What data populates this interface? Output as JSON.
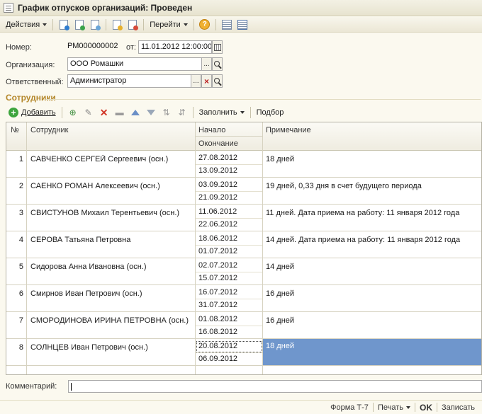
{
  "window": {
    "title": "График отпусков организаций: Проведен"
  },
  "toolbar": {
    "actions_label": "Действия",
    "goto_label": "Перейти"
  },
  "header": {
    "number_label": "Номер:",
    "number_value": "РМ000000002",
    "date_label": "от:",
    "date_value": "11.01.2012 12:00:00",
    "org_label": "Организация:",
    "org_value": "ООО Ромашки",
    "resp_label": "Ответственный:",
    "resp_value": "Администратор"
  },
  "section": {
    "title": "Сотрудники"
  },
  "table_toolbar": {
    "add_label": "Добавить",
    "fill_label": "Заполнить",
    "select_label": "Подбор"
  },
  "table": {
    "columns": {
      "num": "№",
      "employee": "Сотрудник",
      "start": "Начало",
      "end": "Окончание",
      "note": "Примечание"
    },
    "rows": [
      {
        "num": "1",
        "employee": "САВЧЕНКО СЕРГЕЙ Сергеевич  (осн.)",
        "start": "27.08.2012",
        "end": "13.09.2012",
        "note": "18 дней"
      },
      {
        "num": "2",
        "employee": "САЕНКО РОМАН Алексеевич  (осн.)",
        "start": "03.09.2012",
        "end": "21.09.2012",
        "note": "19 дней, 0,33 дня в счет будущего периода"
      },
      {
        "num": "3",
        "employee": "СВИСТУНОВ Михаил Терентьевич  (осн.)",
        "start": "11.06.2012",
        "end": "22.06.2012",
        "note": "11 дней. Дата приема на работу: 11 января 2012 года"
      },
      {
        "num": "4",
        "employee": "СЕРОВА Татьяна Петровна",
        "start": "18.06.2012",
        "end": "01.07.2012",
        "note": "14 дней. Дата приема на работу: 11 января 2012 года"
      },
      {
        "num": "5",
        "employee": "Сидорова Анна Ивановна  (осн.)",
        "start": "02.07.2012",
        "end": "15.07.2012",
        "note": "14 дней"
      },
      {
        "num": "6",
        "employee": "Смирнов Иван Петрович  (осн.)",
        "start": "16.07.2012",
        "end": "31.07.2012",
        "note": "16 дней"
      },
      {
        "num": "7",
        "employee": "СМОРОДИНОВА ИРИНА ПЕТРОВНА  (осн.)",
        "start": "01.08.2012",
        "end": "16.08.2012",
        "note": "16 дней"
      },
      {
        "num": "8",
        "employee": "СОЛНЦЕВ Иван Петрович  (осн.)",
        "start": "20.08.2012",
        "end": "06.09.2012",
        "note": "18 дней"
      }
    ]
  },
  "comment": {
    "label": "Комментарий:",
    "value": ""
  },
  "footer": {
    "form_label": "Форма Т-7",
    "print_label": "Печать",
    "ok_label": "OK",
    "save_label": "Записать"
  },
  "colors": {
    "accent": "#b4872a",
    "selection": "#6f96cc"
  }
}
